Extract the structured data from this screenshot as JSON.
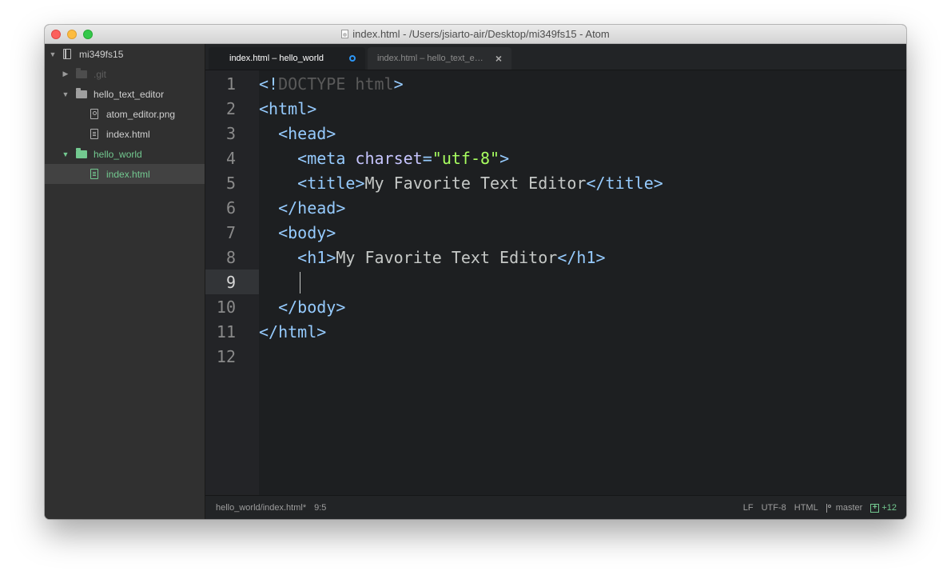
{
  "window": {
    "title": "index.html - /Users/jsiarto-air/Desktop/mi349fs15 - Atom"
  },
  "sidebar": {
    "project_root": "mi349fs15",
    "items": [
      {
        "label": ".git",
        "type": "folder",
        "state": "collapsed",
        "dimmed": true
      },
      {
        "label": "hello_text_editor",
        "type": "folder",
        "state": "expanded"
      },
      {
        "label": "atom_editor.png",
        "type": "image-file"
      },
      {
        "label": "index.html",
        "type": "file"
      },
      {
        "label": "hello_world",
        "type": "folder",
        "state": "expanded",
        "status": "new"
      },
      {
        "label": "index.html",
        "type": "file",
        "status": "new",
        "selected": true
      }
    ]
  },
  "tabs": [
    {
      "label": "index.html – hello_world",
      "active": true,
      "modified": true
    },
    {
      "label": "index.html – hello_text_e…",
      "active": false
    }
  ],
  "editor": {
    "line_numbers": [
      "1",
      "2",
      "3",
      "4",
      "5",
      "6",
      "7",
      "8",
      "9",
      "10",
      "11",
      "12"
    ],
    "current_line": "9",
    "lines": [
      [
        [
          "p",
          "<"
        ],
        [
          "p",
          "!"
        ],
        [
          "dim",
          "DOCTYPE html"
        ],
        [
          "p",
          ">"
        ]
      ],
      [
        [
          "p",
          "<"
        ],
        [
          "tag",
          "html"
        ],
        [
          "p",
          ">"
        ]
      ],
      [
        [
          "p",
          "  <"
        ],
        [
          "tag",
          "head"
        ],
        [
          "p",
          ">"
        ]
      ],
      [
        [
          "p",
          "    <"
        ],
        [
          "tag",
          "meta "
        ],
        [
          "attr",
          "charset"
        ],
        [
          "p",
          "="
        ],
        [
          "str",
          "\"utf-8\""
        ],
        [
          "p",
          ">"
        ]
      ],
      [
        [
          "p",
          "    <"
        ],
        [
          "tag",
          "title"
        ],
        [
          "p",
          ">"
        ],
        [
          "txt",
          "My Favorite Text Editor"
        ],
        [
          "p",
          "</"
        ],
        [
          "tag",
          "title"
        ],
        [
          "p",
          ">"
        ]
      ],
      [
        [
          "p",
          "  </"
        ],
        [
          "tag",
          "head"
        ],
        [
          "p",
          ">"
        ]
      ],
      [
        [
          "p",
          "  <"
        ],
        [
          "tag",
          "body"
        ],
        [
          "p",
          ">"
        ]
      ],
      [
        [
          "p",
          "    <"
        ],
        [
          "tag",
          "h1"
        ],
        [
          "p",
          ">"
        ],
        [
          "txt",
          "My Favorite Text Editor"
        ],
        [
          "p",
          "</"
        ],
        [
          "tag",
          "h1"
        ],
        [
          "p",
          ">"
        ]
      ],
      [
        [
          "txt",
          "    "
        ]
      ],
      [
        [
          "p",
          "  </"
        ],
        [
          "tag",
          "body"
        ],
        [
          "p",
          ">"
        ]
      ],
      [
        [
          "p",
          "</"
        ],
        [
          "tag",
          "html"
        ],
        [
          "p",
          ">"
        ]
      ],
      [
        [
          "txt",
          ""
        ]
      ]
    ]
  },
  "statusbar": {
    "file_path": "hello_world/index.html*",
    "cursor_position": "9:5",
    "line_ending": "LF",
    "encoding": "UTF-8",
    "grammar": "HTML",
    "branch": "master",
    "diff_count": "+12"
  },
  "colors": {
    "accent_blue": "#2d96f5",
    "git_new_green": "#73c990",
    "tag_blue": "#96cbfe",
    "attr_purple": "#c6c5fe",
    "string_green": "#a8ff60"
  }
}
